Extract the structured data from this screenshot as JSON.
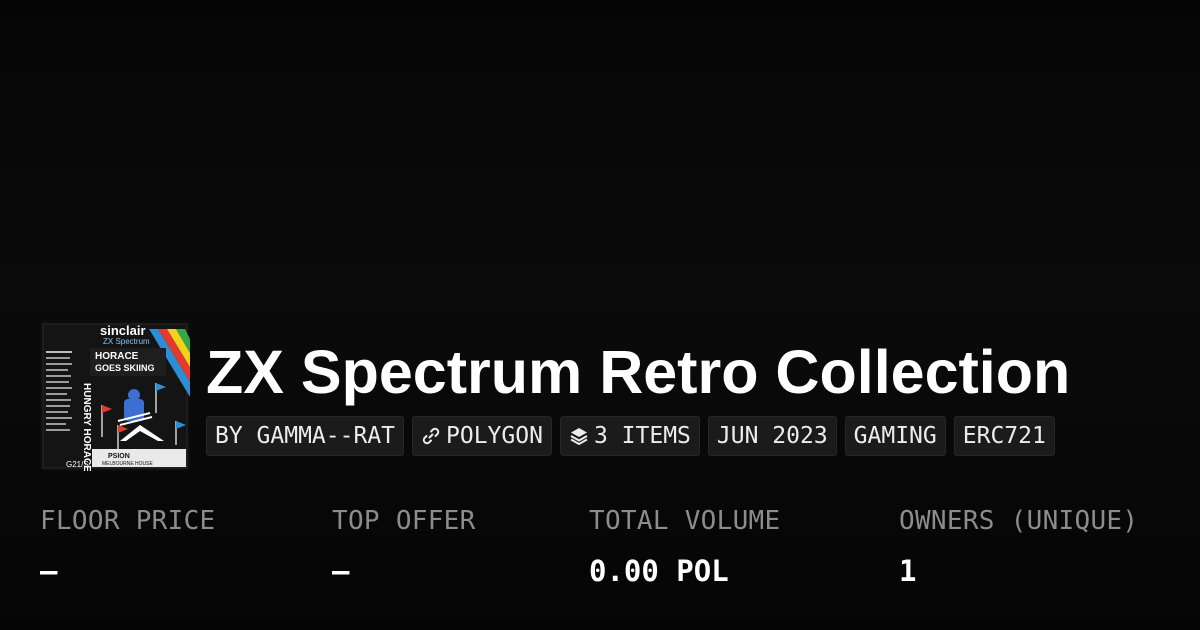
{
  "collection": {
    "title": "ZX Spectrum Retro Collection",
    "image_icon": "game-cover-art",
    "cover_text": {
      "brand": "sinclair",
      "platform": "ZX Spectrum",
      "game_title_line1": "HORACE",
      "game_title_line2": "GOES SKIING",
      "spine_title": "HUNGRY HORACE",
      "catalog_code": "G21/S",
      "publisher": "PSION",
      "distributor": "MELBOURNE HOUSE"
    }
  },
  "tags": [
    {
      "label": "BY GAMMA--RAT",
      "icon": ""
    },
    {
      "label": "POLYGON",
      "icon": "polygon-link-icon"
    },
    {
      "label": "3 ITEMS",
      "icon": "layers-icon"
    },
    {
      "label": "JUN 2023",
      "icon": ""
    },
    {
      "label": "GAMING",
      "icon": ""
    },
    {
      "label": "ERC721",
      "icon": ""
    }
  ],
  "stats": [
    {
      "label": "FLOOR PRICE",
      "value": "—"
    },
    {
      "label": "TOP OFFER",
      "value": "—"
    },
    {
      "label": "TOTAL VOLUME",
      "value": "0.00 POL"
    },
    {
      "label": "OWNERS (UNIQUE)",
      "value": "1"
    }
  ],
  "colors": {
    "background": "#0a0a0a",
    "tag_background": "#1b1b1b",
    "label_gray": "#8c8c8c",
    "text": "#ffffff",
    "stripe_red": "#e23a2c",
    "stripe_yellow": "#f3d21b",
    "stripe_green": "#36a84b",
    "stripe_blue": "#2b8fd6"
  }
}
